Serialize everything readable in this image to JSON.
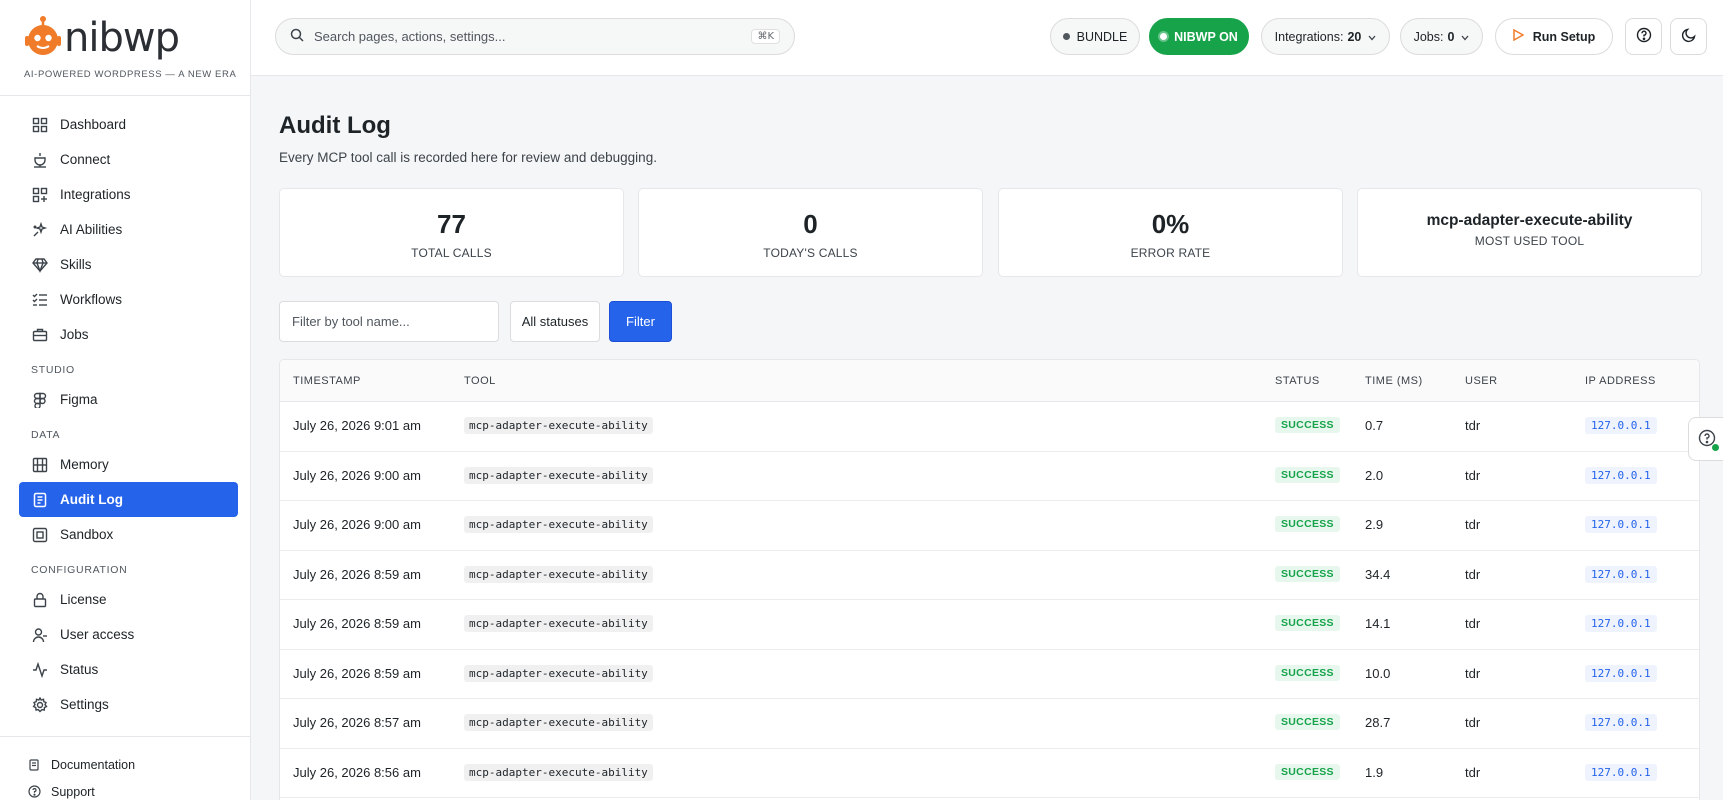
{
  "brand": {
    "name": "nibwp",
    "tagline": "AI-POWERED WORDPRESS — A NEW ERA",
    "accent": "#2563eb",
    "logo_color": "#f07c2a"
  },
  "sidebar": {
    "items_main": [
      {
        "label": "Dashboard",
        "icon": "grid-icon"
      },
      {
        "label": "Connect",
        "icon": "plug-icon"
      },
      {
        "label": "Integrations",
        "icon": "integrations-icon"
      },
      {
        "label": "AI Abilities",
        "icon": "sparkles-icon"
      },
      {
        "label": "Skills",
        "icon": "gem-icon"
      },
      {
        "label": "Workflows",
        "icon": "list-check-icon"
      },
      {
        "label": "Jobs",
        "icon": "briefcase-icon"
      }
    ],
    "section_studio": "STUDIO",
    "items_studio": [
      {
        "label": "Figma",
        "icon": "figma-icon"
      }
    ],
    "section_data": "DATA",
    "items_data": [
      {
        "label": "Memory",
        "icon": "memory-icon"
      },
      {
        "label": "Audit Log",
        "icon": "document-icon"
      },
      {
        "label": "Sandbox",
        "icon": "sandbox-icon"
      }
    ],
    "section_config": "CONFIGURATION",
    "items_config": [
      {
        "label": "License",
        "icon": "lock-icon"
      },
      {
        "label": "User access",
        "icon": "user-icon"
      },
      {
        "label": "Status",
        "icon": "activity-icon"
      },
      {
        "label": "Settings",
        "icon": "gear-icon"
      }
    ],
    "bottom": [
      {
        "label": "Documentation",
        "icon": "book-icon"
      },
      {
        "label": "Support",
        "icon": "help-icon"
      }
    ]
  },
  "header": {
    "search_placeholder": "Search pages, actions, settings...",
    "search_shortcut": "⌘K",
    "bundle_label": "BUNDLE",
    "nibwp_on_label": "NIBWP ON",
    "integrations_label": "Integrations:",
    "integrations_count": "20",
    "jobs_label": "Jobs:",
    "jobs_count": "0",
    "run_setup_label": "Run Setup"
  },
  "main": {
    "title": "Audit Log",
    "subtitle": "Every MCP tool call is recorded here for review and debugging.",
    "stats": [
      {
        "value": "77",
        "label": "TOTAL CALLS"
      },
      {
        "value": "0",
        "label": "TODAY'S CALLS"
      },
      {
        "value": "0%",
        "label": "ERROR RATE"
      },
      {
        "value": "mcp-adapter-execute-ability",
        "label": "MOST USED TOOL"
      }
    ],
    "filter_placeholder": "Filter by tool name...",
    "status_select": "All statuses",
    "filter_button": "Filter",
    "columns": [
      "TIMESTAMP",
      "TOOL",
      "STATUS",
      "TIME (MS)",
      "USER",
      "IP ADDRESS"
    ],
    "rows": [
      {
        "timestamp": "July 26, 2026 9:01 am",
        "tool": "mcp-adapter-execute-ability",
        "status": "SUCCESS",
        "time": "0.7",
        "user": "tdr",
        "ip": "127.0.0.1"
      },
      {
        "timestamp": "July 26, 2026 9:00 am",
        "tool": "mcp-adapter-execute-ability",
        "status": "SUCCESS",
        "time": "2.0",
        "user": "tdr",
        "ip": "127.0.0.1"
      },
      {
        "timestamp": "July 26, 2026 9:00 am",
        "tool": "mcp-adapter-execute-ability",
        "status": "SUCCESS",
        "time": "2.9",
        "user": "tdr",
        "ip": "127.0.0.1"
      },
      {
        "timestamp": "July 26, 2026 8:59 am",
        "tool": "mcp-adapter-execute-ability",
        "status": "SUCCESS",
        "time": "34.4",
        "user": "tdr",
        "ip": "127.0.0.1"
      },
      {
        "timestamp": "July 26, 2026 8:59 am",
        "tool": "mcp-adapter-execute-ability",
        "status": "SUCCESS",
        "time": "14.1",
        "user": "tdr",
        "ip": "127.0.0.1"
      },
      {
        "timestamp": "July 26, 2026 8:59 am",
        "tool": "mcp-adapter-execute-ability",
        "status": "SUCCESS",
        "time": "10.0",
        "user": "tdr",
        "ip": "127.0.0.1"
      },
      {
        "timestamp": "July 26, 2026 8:57 am",
        "tool": "mcp-adapter-execute-ability",
        "status": "SUCCESS",
        "time": "28.7",
        "user": "tdr",
        "ip": "127.0.0.1"
      },
      {
        "timestamp": "July 26, 2026 8:56 am",
        "tool": "mcp-adapter-execute-ability",
        "status": "SUCCESS",
        "time": "1.9",
        "user": "tdr",
        "ip": "127.0.0.1"
      }
    ]
  }
}
